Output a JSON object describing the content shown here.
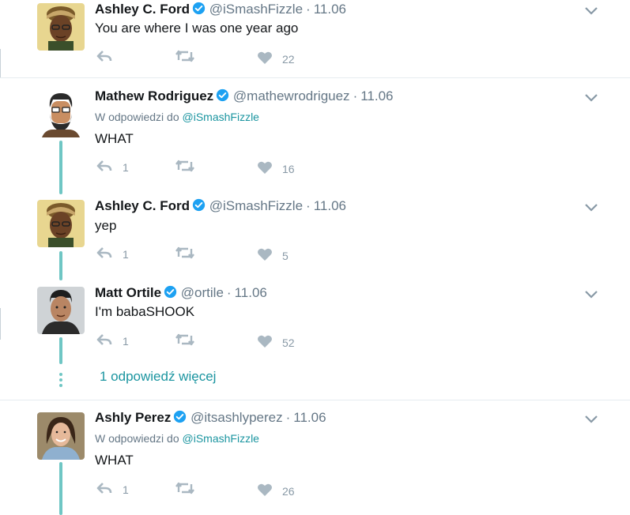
{
  "tweets": [
    {
      "name": "Ashley C. Ford",
      "handle": "@iSmashFizzle",
      "dot": "·",
      "time": "11.06",
      "text": "You are where I was one year ago",
      "reply_count": "",
      "like_count": "22"
    },
    {
      "name": "Mathew Rodriguez",
      "handle": "@mathewrodriguez",
      "dot": "·",
      "time": "11.06",
      "reply_prefix": "W odpowiedzi do",
      "reply_to": "@iSmashFizzle",
      "text": "WHAT",
      "reply_count": "1",
      "like_count": "16"
    },
    {
      "name": "Ashley C. Ford",
      "handle": "@iSmashFizzle",
      "dot": "·",
      "time": "11.06",
      "text": "yep",
      "reply_count": "1",
      "like_count": "5"
    },
    {
      "name": "Matt Ortile",
      "handle": "@ortile",
      "dot": "·",
      "time": "11.06",
      "text": "I'm babaSHOOK",
      "reply_count": "1",
      "like_count": "52"
    },
    {
      "name": "Ashly Perez",
      "handle": "@itsashlyperez",
      "dot": "·",
      "time": "11.06",
      "reply_prefix": "W odpowiedzi do",
      "reply_to": "@iSmashFizzle",
      "text": "WHAT",
      "reply_count": "1",
      "like_count": "26"
    }
  ],
  "more_replies_label": "1 odpowiedź więcej",
  "icons": {
    "verified": "verified-badge-icon",
    "reply": "reply-icon",
    "retweet": "retweet-icon",
    "like": "heart-icon",
    "menu": "chevron-down-icon"
  },
  "colors": {
    "verified": "#1da1f2",
    "thread_line": "#6fc6c4",
    "link": "#1b95a0",
    "icon_gray": "#aab8c2",
    "muted_text": "#657786"
  }
}
